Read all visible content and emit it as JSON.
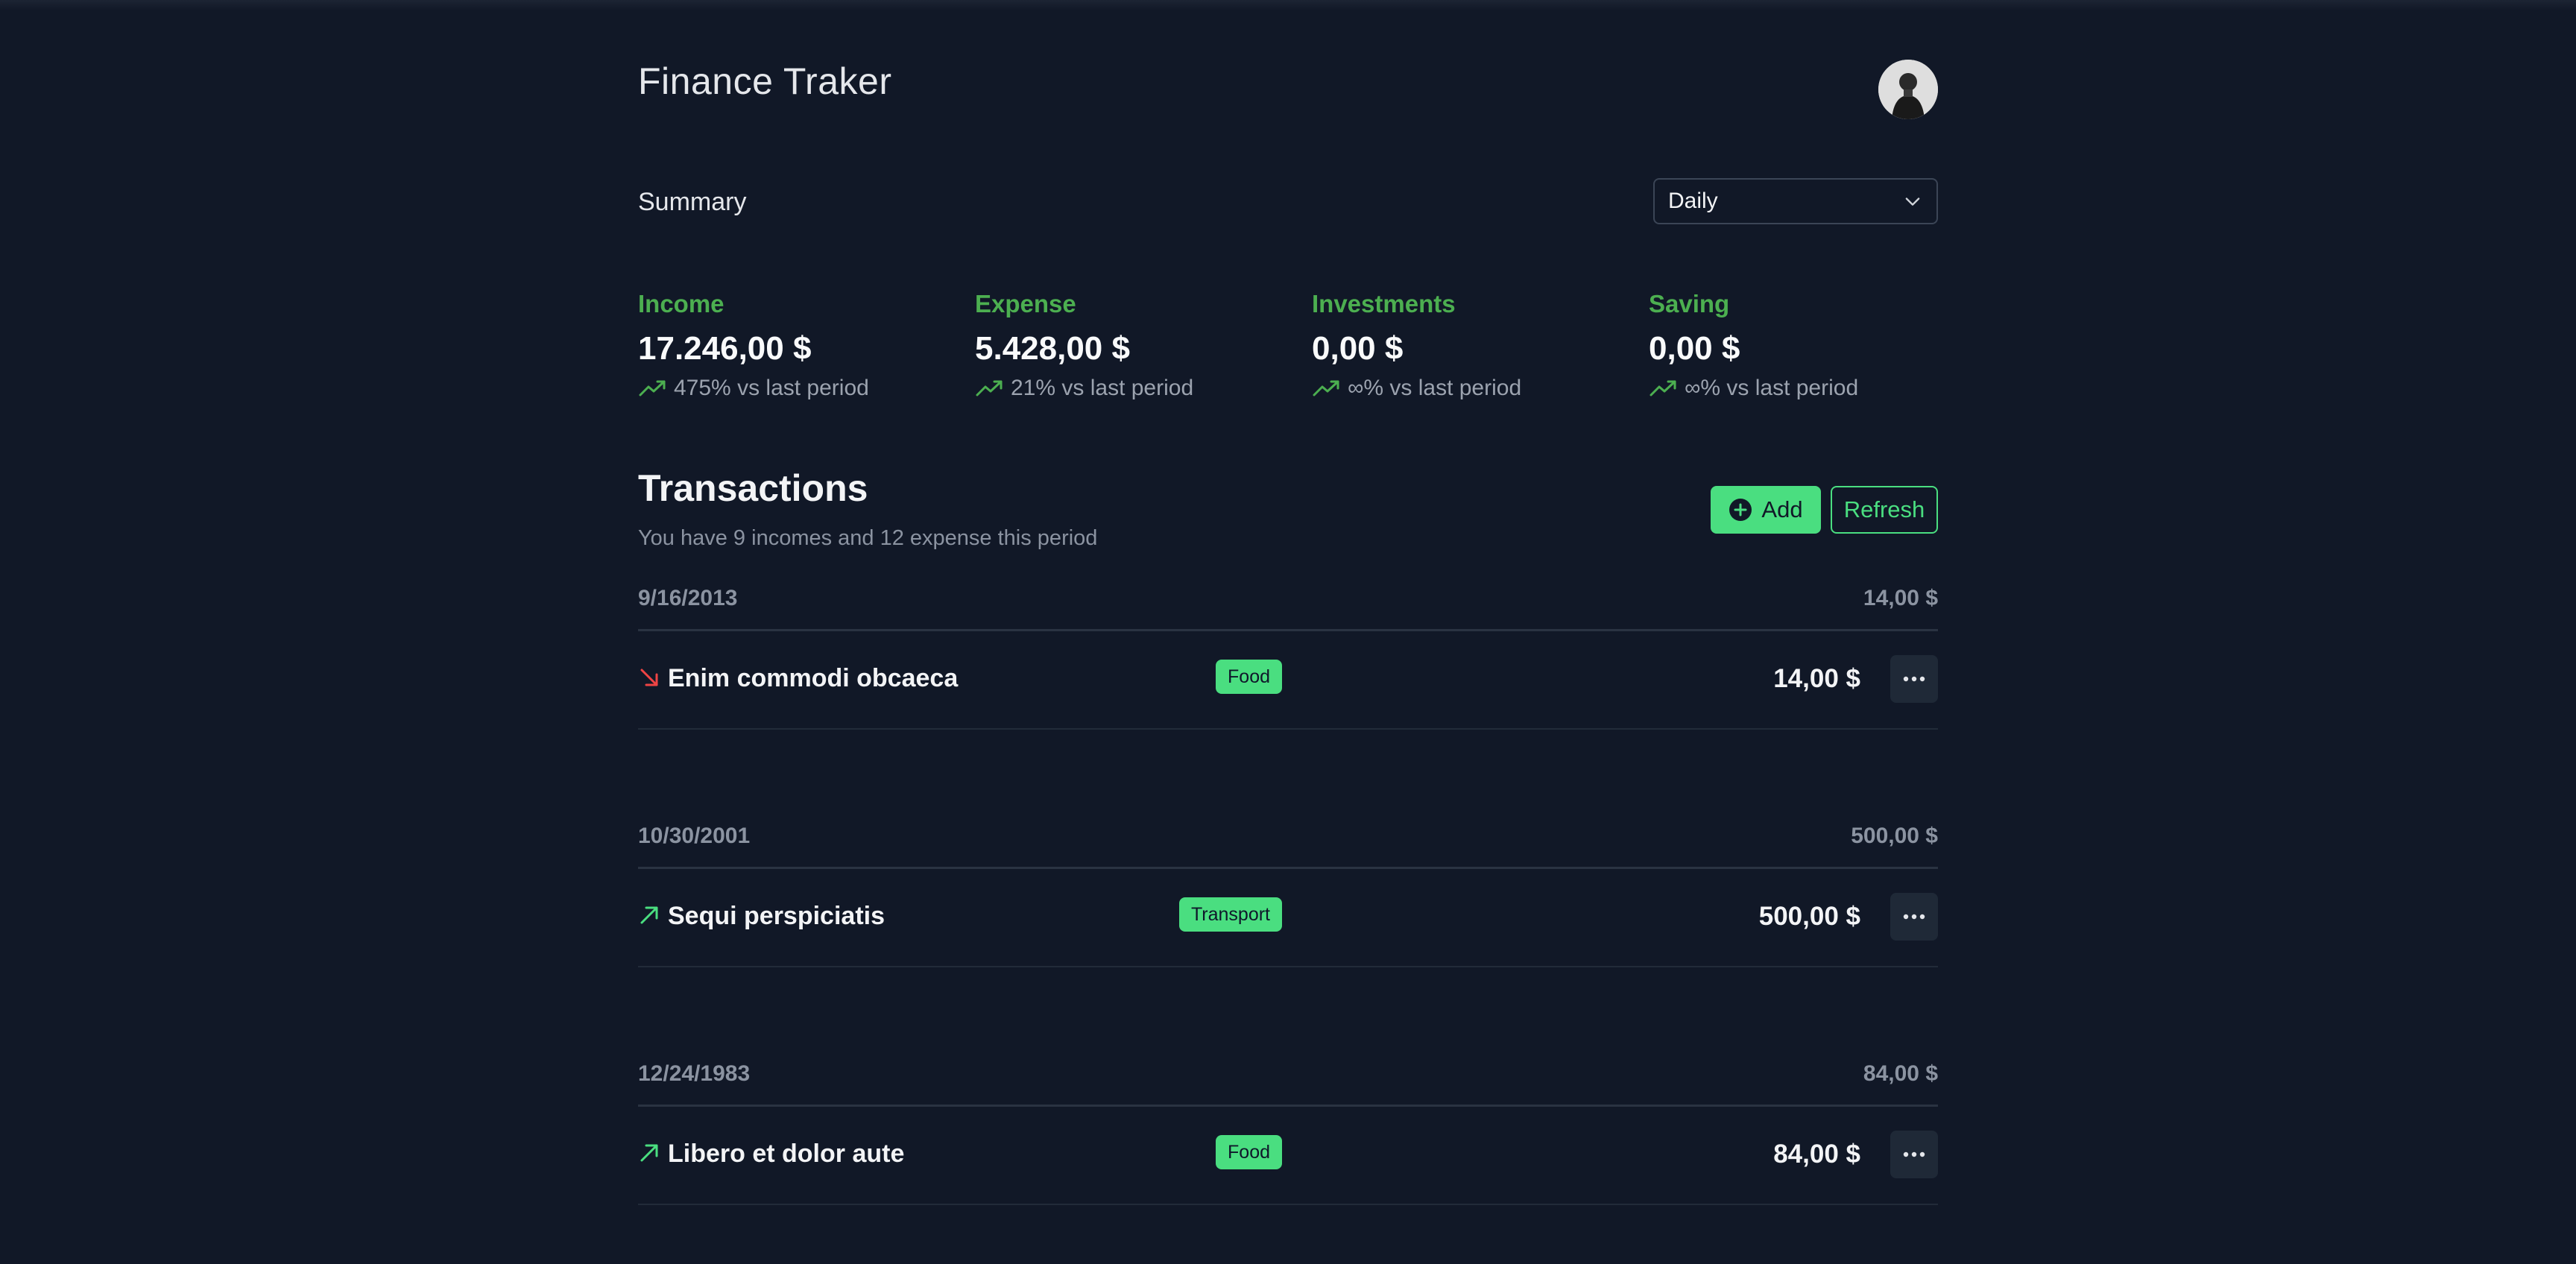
{
  "app": {
    "title": "Finance Traker"
  },
  "summary": {
    "title": "Summary",
    "period": {
      "selected": "Daily"
    },
    "stats": [
      {
        "label": "Income",
        "value": "17.246,00 $",
        "change": "475% vs last period"
      },
      {
        "label": "Expense",
        "value": "5.428,00 $",
        "change": "21% vs last period"
      },
      {
        "label": "Investments",
        "value": "0,00 $",
        "change": "∞% vs last period"
      },
      {
        "label": "Saving",
        "value": "0,00 $",
        "change": "∞% vs last period"
      }
    ]
  },
  "transactions": {
    "title": "Transactions",
    "subtitle": "You have 9 incomes and 12 expense this period",
    "add_label": "Add",
    "refresh_label": "Refresh",
    "groups": [
      {
        "date": "9/16/2013",
        "total": "14,00 $",
        "items": [
          {
            "name": "Enim commodi obcaeca",
            "category": "Food",
            "amount": "14,00 $",
            "direction": "expense"
          }
        ]
      },
      {
        "date": "10/30/2001",
        "total": "500,00 $",
        "items": [
          {
            "name": "Sequi perspiciatis",
            "category": "Transport",
            "amount": "500,00 $",
            "direction": "income"
          }
        ]
      },
      {
        "date": "12/24/1983",
        "total": "84,00 $",
        "items": [
          {
            "name": "Libero et dolor aute",
            "category": "Food",
            "amount": "84,00 $",
            "direction": "income"
          }
        ]
      }
    ]
  },
  "colors": {
    "accent": "#4ade80",
    "stat_label": "#4caf50",
    "expense_arrow": "#ef4444",
    "income_arrow": "#4ade80",
    "background": "#111827"
  },
  "icons": {
    "avatar": "user-avatar",
    "period_chevron": "chevron-down-icon",
    "trend": "trending-up-icon",
    "add": "plus-circle-icon",
    "expense": "arrow-down-right-icon",
    "income": "arrow-up-right-icon",
    "menu": "more-horizontal-icon"
  }
}
